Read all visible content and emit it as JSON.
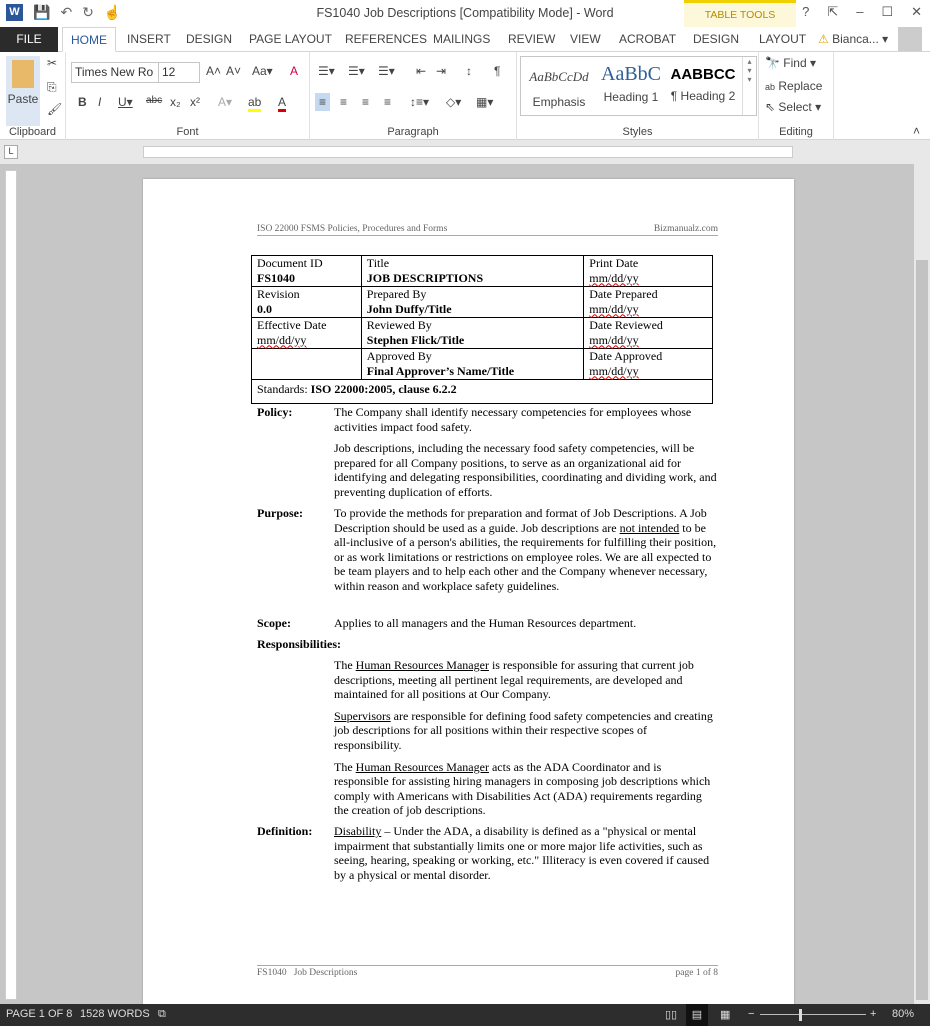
{
  "window": {
    "title": "FS1040 Job Descriptions [Compatibility Mode] - Word",
    "table_tools": "TABLE TOOLS",
    "user": "Bianca..."
  },
  "tabs": [
    "FILE",
    "HOME",
    "INSERT",
    "DESIGN",
    "PAGE LAYOUT",
    "REFERENCES",
    "MAILINGS",
    "REVIEW",
    "VIEW",
    "ACROBAT",
    "DESIGN",
    "LAYOUT"
  ],
  "ribbon": {
    "paste": "Paste",
    "font_name": "Times New Ro",
    "font_size": "12",
    "groups": {
      "clipboard": "Clipboard",
      "font": "Font",
      "paragraph": "Paragraph",
      "styles": "Styles",
      "editing": "Editing"
    },
    "styles": [
      {
        "sample": "AaBbCcDd",
        "name": "Emphasis"
      },
      {
        "sample": "AaBbC",
        "name": "Heading 1"
      },
      {
        "sample": "AABBCC",
        "name": "¶ Heading 2"
      }
    ],
    "find": "Find",
    "replace": "Replace",
    "select": "Select"
  },
  "doc": {
    "header_left": "ISO 22000 FSMS Policies, Procedures and Forms",
    "header_right": "Bizmanualz.com",
    "table": [
      [
        {
          "l": "Document ID",
          "v": "FS1040"
        },
        {
          "l": "Title",
          "v": "JOB DESCRIPTIONS"
        },
        {
          "l": "Print Date",
          "d": "mm/dd/yy"
        }
      ],
      [
        {
          "l": "Revision",
          "v": "0.0"
        },
        {
          "l": "Prepared By",
          "v": "John Duffy/Title"
        },
        {
          "l": "Date Prepared",
          "d": "mm/dd/yy"
        }
      ],
      [
        {
          "l": "Effective Date",
          "d": "mm/dd/yy"
        },
        {
          "l": "Reviewed By",
          "v": "Stephen Flick/Title"
        },
        {
          "l": "Date Reviewed",
          "d": "mm/dd/yy"
        }
      ],
      [
        {
          "l": ""
        },
        {
          "l": "Approved By",
          "v": "Final Approver’s Name/Title"
        },
        {
          "l": "Date Approved",
          "d": "mm/dd/yy"
        }
      ]
    ],
    "standards_label": "Standards: ",
    "standards_value": "ISO 22000:2005, clause 6.2.2",
    "policy": {
      "label": "Policy:",
      "p1": "The Company shall identify necessary competencies for employees whose activities impact food safety.",
      "p2": "Job descriptions, including the necessary food safety competencies, will be prepared for all Company positions, to serve as an organizational aid for identifying and delegating responsibilities, coordinating and dividing work, and preventing duplication of efforts."
    },
    "purpose": {
      "label": "Purpose:",
      "a": "To provide the methods for preparation and format of Job Descriptions.  A Job Description should be used as a guide. Job descriptions are ",
      "u": "not intended",
      "b": " to be all-inclusive of a person's abilities, the requirements for fulfilling their position, or as work limitations or restrictions on employee roles.  We are all expected to be team players and to help each other and the Company whenever necessary, within reason and workplace safety guidelines."
    },
    "scope": {
      "label": "Scope:",
      "text": "Applies to all managers and the Human Resources department."
    },
    "resp": {
      "label": "Responsibilities:",
      "p1a": "The ",
      "p1u": "Human Resources Manager",
      "p1b": " is responsible for assuring that current job descriptions, meeting all pertinent legal requirements, are developed and maintained for all positions at Our Company.",
      "p2u": "Supervisors",
      "p2b": " are responsible for defining food safety competencies and creating job descriptions for all positions within their respective scopes of responsibility.",
      "p3a": "The ",
      "p3u": "Human Resources Manager",
      "p3b": " acts as the ADA Coordinator and is responsible for assisting hiring managers in composing job descriptions which comply with Americans with Disabilities Act (ADA) requirements regarding the creation of job descriptions."
    },
    "definition": {
      "label": "Definition:",
      "u": "Disability",
      "b": " – Under the ADA, a disability is defined as a \"physical or mental impairment that substantially limits one or more major life activities, such as seeing, hearing, speaking or working, etc.\"  Illiteracy is even covered if caused by a physical or mental disorder."
    },
    "footer_left": "FS1040   Job Descriptions",
    "footer_right": "page 1 of 8"
  },
  "status": {
    "page": "PAGE 1 OF 8",
    "words": "1528 WORDS",
    "zoom": "80%"
  },
  "colors": {
    "accent": "#2b579a",
    "status_bg": "#2d2d2d"
  }
}
